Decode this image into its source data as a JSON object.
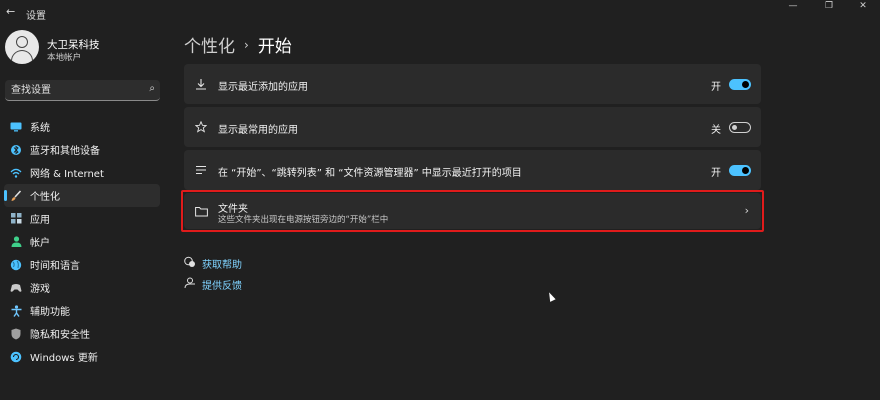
{
  "window": {
    "title": "设置",
    "back_glyph": "←",
    "controls": [
      "—",
      "❐",
      "✕"
    ]
  },
  "user": {
    "name": "大卫呆科技",
    "account_type": "本地帐户"
  },
  "search": {
    "placeholder": "查找设置"
  },
  "sidebar": {
    "items": [
      {
        "label": "系统",
        "icon": "monitor-icon",
        "color": "#4cc2ff",
        "active": false
      },
      {
        "label": "蓝牙和其他设备",
        "icon": "bluetooth-icon",
        "color": "#4cc2ff",
        "active": false
      },
      {
        "label": "网络 & Internet",
        "icon": "wifi-icon",
        "color": "#4cc2ff",
        "active": false
      },
      {
        "label": "个性化",
        "icon": "brush-icon",
        "color": "#e8a15a",
        "active": true
      },
      {
        "label": "应用",
        "icon": "apps-icon",
        "color": "#8fb3c9",
        "active": false
      },
      {
        "label": "帐户",
        "icon": "person-icon",
        "color": "#3fd08a",
        "active": false
      },
      {
        "label": "时间和语言",
        "icon": "globe-icon",
        "color": "#4cc2ff",
        "active": false
      },
      {
        "label": "游戏",
        "icon": "gamepad-icon",
        "color": "#c9c9c9",
        "active": false
      },
      {
        "label": "辅助功能",
        "icon": "accessibility-icon",
        "color": "#6fc7ff",
        "active": false
      },
      {
        "label": "隐私和安全性",
        "icon": "shield-icon",
        "color": "#a0a0a0",
        "active": false
      },
      {
        "label": "Windows 更新",
        "icon": "update-icon",
        "color": "#4cc2ff",
        "active": false
      }
    ]
  },
  "breadcrumb": {
    "parent": "个性化",
    "separator": "›",
    "current": "开始"
  },
  "settings": [
    {
      "label": "显示最近添加的应用",
      "icon": "download-icon",
      "state": "开",
      "on": true
    },
    {
      "label": "显示最常用的应用",
      "icon": "star-icon",
      "state": "关",
      "on": false
    },
    {
      "label": "在 “开始”、“跳转列表” 和 “文件资源管理器” 中显示最近打开的项目",
      "icon": "list-icon",
      "state": "开",
      "on": true
    },
    {
      "label": "文件夹",
      "sublabel": "这些文件夹出现在电源按钮旁边的“开始”栏中",
      "icon": "folder-icon",
      "chevron": "›"
    }
  ],
  "links": [
    {
      "label": "获取帮助",
      "icon": "help-icon"
    },
    {
      "label": "提供反馈",
      "icon": "feedback-icon"
    }
  ],
  "colors": {
    "accent": "#4cc2ff",
    "highlight_box": "#e01b1b",
    "background": "#202020",
    "card": "#2b2b2b"
  }
}
